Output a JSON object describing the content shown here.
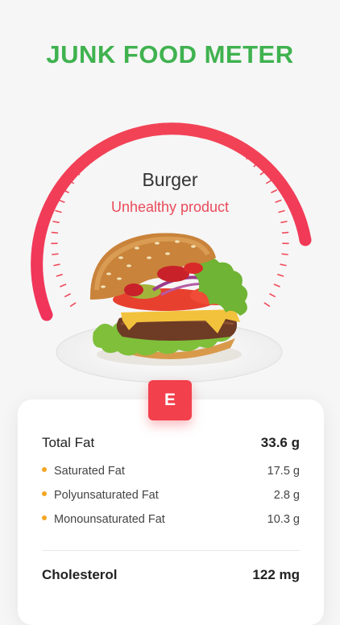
{
  "header": {
    "title": "JUNK FOOD METER"
  },
  "product": {
    "name": "Burger",
    "status": "Unhealthy product",
    "grade": "E",
    "image_icon": "burger-image"
  },
  "colors": {
    "brand_green": "#3fb24f",
    "danger_red": "#f2404c",
    "bullet_orange": "#f5a623"
  },
  "meter": {
    "level": 1.0
  },
  "nutrition": {
    "total_fat": {
      "label": "Total Fat",
      "value": "33.6 g"
    },
    "sub_items": [
      {
        "label": "Saturated Fat",
        "value": "17.5 g"
      },
      {
        "label": "Polyunsaturated Fat",
        "value": "2.8 g"
      },
      {
        "label": "Monounsaturated Fat",
        "value": "10.3 g"
      }
    ],
    "cholesterol": {
      "label": "Cholesterol",
      "value": "122 mg"
    }
  }
}
